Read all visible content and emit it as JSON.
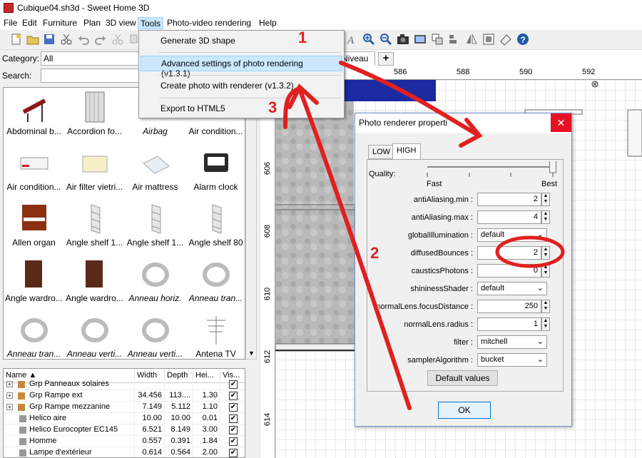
{
  "window": {
    "title": "Cubique04.sh3d - Sweet Home 3D"
  },
  "menubar": {
    "items": [
      "File",
      "Edit",
      "Furniture",
      "Plan",
      "3D view",
      "Tools",
      "Photo-video rendering",
      "Help"
    ]
  },
  "left": {
    "category_label": "Category:",
    "category_value": "All",
    "search_label": "Search:",
    "search_value": "",
    "catalog": [
      {
        "label": "Abdominal b...",
        "icon": "bench-icon",
        "italic": false
      },
      {
        "label": "Accordion fo...",
        "icon": "door-icon",
        "italic": false
      },
      {
        "label": "Airbag",
        "icon": "airbag-icon",
        "italic": true
      },
      {
        "label": "Air condition...",
        "icon": "air-conditioner-icon",
        "italic": false
      },
      {
        "label": "Air condition...",
        "icon": "air-conditioner-icon",
        "italic": false
      },
      {
        "label": "Air filter vietri...",
        "icon": "air-filter-icon",
        "italic": false
      },
      {
        "label": "Air mattress",
        "icon": "mattress-icon",
        "italic": false
      },
      {
        "label": "Alarm clock",
        "icon": "clock-icon",
        "italic": false
      },
      {
        "label": "Allen organ",
        "icon": "organ-icon",
        "italic": false
      },
      {
        "label": "Angle shelf 1...",
        "icon": "shelf-icon",
        "italic": false
      },
      {
        "label": "Angle shelf 1...",
        "icon": "shelf-icon",
        "italic": false
      },
      {
        "label": "Angle shelf 80",
        "icon": "shelf-icon",
        "italic": false
      },
      {
        "label": "Angle wardro...",
        "icon": "wardrobe-icon",
        "italic": false
      },
      {
        "label": "Angle wardro...",
        "icon": "wardrobe-icon",
        "italic": false
      },
      {
        "label": "Anneau horiz.",
        "icon": "ring-icon",
        "italic": true
      },
      {
        "label": "Anneau tran...",
        "icon": "ring-icon",
        "italic": true
      },
      {
        "label": "Anneau tran...",
        "icon": "ring-icon",
        "italic": true
      },
      {
        "label": "Anneau verti...",
        "icon": "ring-icon",
        "italic": true
      },
      {
        "label": "Anneau verti...",
        "icon": "ring-icon",
        "italic": true
      },
      {
        "label": "Antena TV",
        "icon": "antenna-icon",
        "italic": false
      }
    ],
    "table": {
      "headers": [
        "Name ▲",
        "Width",
        "Depth",
        "Hei...",
        "Vis..."
      ],
      "rows": [
        {
          "name": "Grp Panneaux solaires",
          "w": "",
          "d": "",
          "h": "",
          "vis": true,
          "group": true
        },
        {
          "name": "Grp Rampe ext",
          "w": "34.456",
          "d": "113....",
          "h": "1.30",
          "vis": true,
          "group": true
        },
        {
          "name": "Grp Rampe mezzanine",
          "w": "7.149",
          "d": "5.112",
          "h": "1.10",
          "vis": true,
          "group": true
        },
        {
          "name": "Helico aire",
          "w": "10.00",
          "d": "10.00",
          "h": "0.01",
          "vis": true,
          "group": false
        },
        {
          "name": "Helico Eurocopter EC145",
          "w": "6.521",
          "d": "8.149",
          "h": "3.00",
          "vis": true,
          "group": false
        },
        {
          "name": "Homme",
          "w": "0.557",
          "d": "0.391",
          "h": "1.84",
          "vis": true,
          "group": false
        },
        {
          "name": "Lampe d'extérieur",
          "w": "0.614",
          "d": "0.564",
          "h": "2.00",
          "vis": true,
          "group": false
        }
      ]
    }
  },
  "plan": {
    "level_tab": "Niveau 2",
    "add_tab": "+",
    "ruler_top": [
      "586",
      "588",
      "590",
      "592"
    ],
    "ruler_left": [
      "606",
      "608",
      "610",
      "612",
      "614"
    ]
  },
  "tools_menu": {
    "items": [
      "Generate 3D shape",
      "Advanced settings of photo rendering (v1.3.1)",
      "Create photo with renderer (v1.3.2)",
      "Export to HTML5"
    ]
  },
  "dialog": {
    "title": "Photo renderer properti",
    "close": "✕",
    "tabs": [
      "LOW",
      "HIGH"
    ],
    "quality_label": "Quality:",
    "quality_fast": "Fast",
    "quality_best": "Best",
    "quality_level": 1.0,
    "fields": [
      {
        "label": "antiAliasing.min :",
        "value": "2",
        "kind": "spin"
      },
      {
        "label": "antiAliasing.max :",
        "value": "4",
        "kind": "spin"
      },
      {
        "label": "globalIllumination :",
        "value": "default",
        "kind": "combo"
      },
      {
        "label": "diffusedBounces :",
        "value": "2",
        "kind": "spin"
      },
      {
        "label": "causticsPhotons :",
        "value": "0",
        "kind": "spin"
      },
      {
        "label": "shininessShader :",
        "value": "default",
        "kind": "combo"
      },
      {
        "label": "normalLens.focusDistance :",
        "value": "250",
        "kind": "spin"
      },
      {
        "label": "normalLens.radius :",
        "value": "1",
        "kind": "spin"
      },
      {
        "label": "filter :",
        "value": "mitchell",
        "kind": "combo"
      },
      {
        "label": "samplerAlgorithm :",
        "value": "bucket",
        "kind": "combo"
      }
    ],
    "default_button": "Default values",
    "ok_button": "OK"
  },
  "annotations": {
    "n1": "1",
    "n2": "2",
    "n3": "3",
    "color": "#e02020"
  }
}
